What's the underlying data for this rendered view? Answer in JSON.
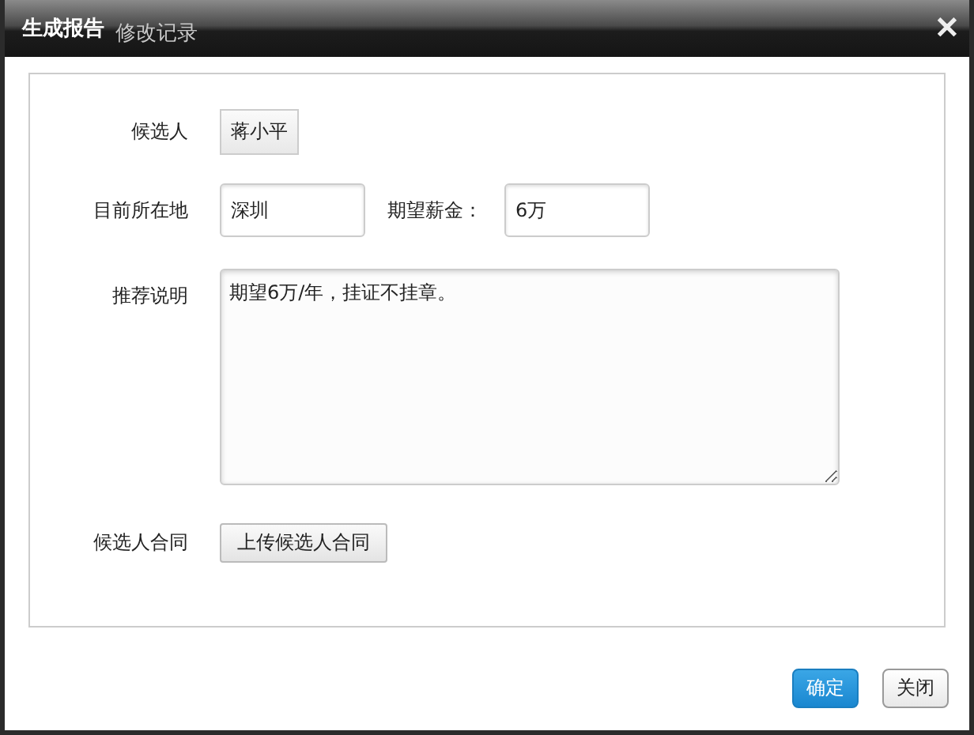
{
  "background_tab": {
    "label": "修改记录"
  },
  "window": {
    "title": "生成报告",
    "close": "✕"
  },
  "form": {
    "candidate": {
      "label": "候选人",
      "value": "蒋小平"
    },
    "location": {
      "label": "目前所在地",
      "value": "深圳"
    },
    "salary": {
      "label": "期望薪金：",
      "value": "6万"
    },
    "recommendation": {
      "label": "推荐说明",
      "value": "期望6万/年，挂证不挂章。"
    },
    "contract": {
      "label": "候选人合同",
      "button": "上传候选人合同"
    }
  },
  "buttons": [
    {
      "label": "确定",
      "kind": "primary"
    },
    {
      "label": "关闭",
      "kind": "secondary"
    }
  ]
}
